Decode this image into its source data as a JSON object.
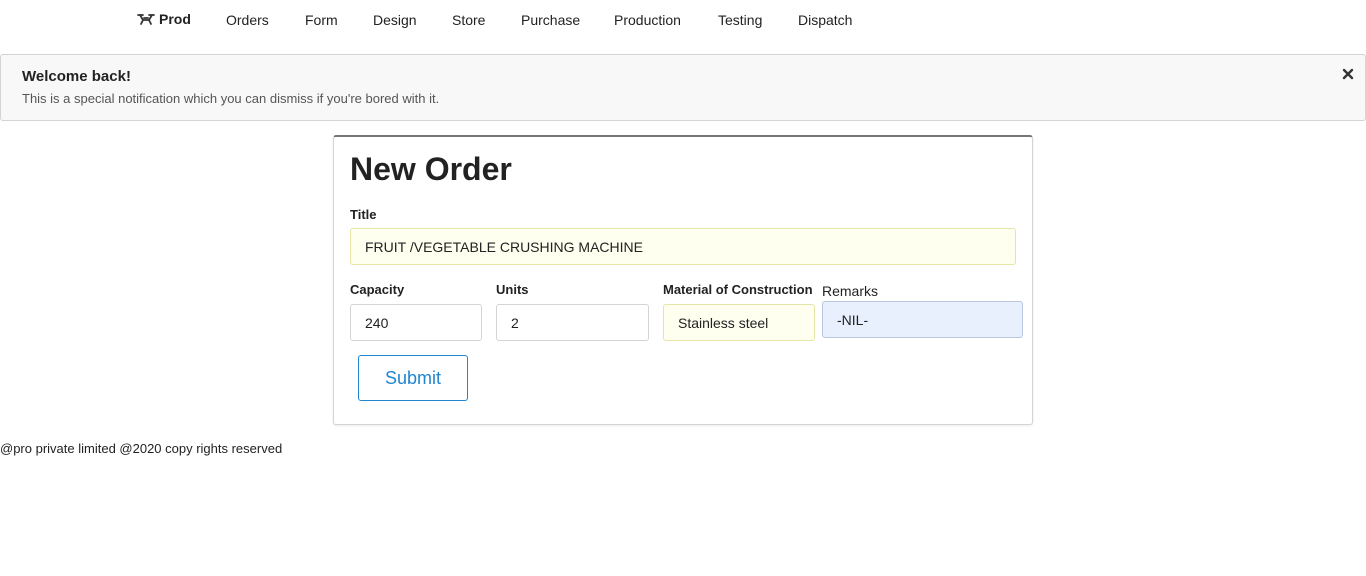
{
  "nav": {
    "brand": "Prod",
    "items": [
      "Orders",
      "Form",
      "Design",
      "Store",
      "Purchase",
      "Production",
      "Testing",
      "Dispatch"
    ]
  },
  "message": {
    "header": "Welcome back!",
    "body": "This is a special notification which you can dismiss if you're bored with it."
  },
  "form": {
    "title": "New Order",
    "title_label": "Title",
    "title_value": "FRUIT /VEGETABLE CRUSHING MACHINE",
    "capacity_label": "Capacity",
    "capacity_value": "240",
    "units_label": "Units",
    "units_value": "2",
    "material_label": "Material of Construction",
    "material_value": "Stainless steel",
    "remarks_label": "Remarks",
    "remarks_value": "-NIL-",
    "submit_label": "Submit"
  },
  "footer": {
    "text": "@pro private limited @2020 copy rights reserved"
  },
  "colors": {
    "accent": "#2185d0",
    "autofill": "#fffff0",
    "remarks_bg": "#e8f0fe"
  },
  "icons": {
    "brand": "drone-icon",
    "close": "close-icon"
  }
}
